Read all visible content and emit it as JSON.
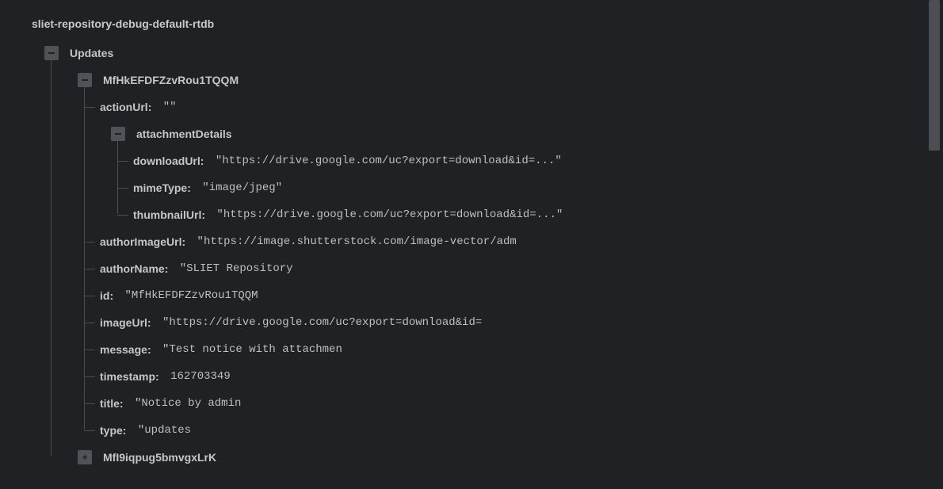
{
  "root": "sliet-repository-debug-default-rtdb",
  "tree": {
    "updatesKey": "Updates",
    "record1": {
      "id": "MfHkEFDFZzvRou1TQQM",
      "fields": {
        "actionUrl": {
          "k": "actionUrl",
          "v": " \"\""
        },
        "attachmentDetailsKey": "attachmentDetails",
        "attach": {
          "downloadUrl": {
            "k": "downloadUrl",
            "v": " \"https://drive.google.com/uc?export=download&id=...\""
          },
          "mimeType": {
            "k": "mimeType",
            "v": " \"image/jpeg\""
          },
          "thumbnailUrl": {
            "k": "thumbnailUrl",
            "v": " \"https://drive.google.com/uc?export=download&id=...\""
          }
        },
        "authorImageUrl": {
          "k": "authorImageUrl",
          "v": " \"https://image.shutterstock.com/image-vector/adm"
        },
        "authorName": {
          "k": "authorName",
          "v": " \"SLIET Repository"
        },
        "idField": {
          "k": "id",
          "v": " \"MfHkEFDFZzvRou1TQQM"
        },
        "imageUrl": {
          "k": "imageUrl",
          "v": " \"https://drive.google.com/uc?export=download&id="
        },
        "message": {
          "k": "message",
          "v": " \"Test notice with attachmen"
        },
        "timestamp": {
          "k": "timestamp",
          "v": " 162703349"
        },
        "title": {
          "k": "title",
          "v": " \"Notice by admin"
        },
        "type": {
          "k": "type",
          "v": " \"updates"
        }
      }
    },
    "record2": {
      "id": "MfI9iqpug5bmvgxLrK"
    }
  }
}
